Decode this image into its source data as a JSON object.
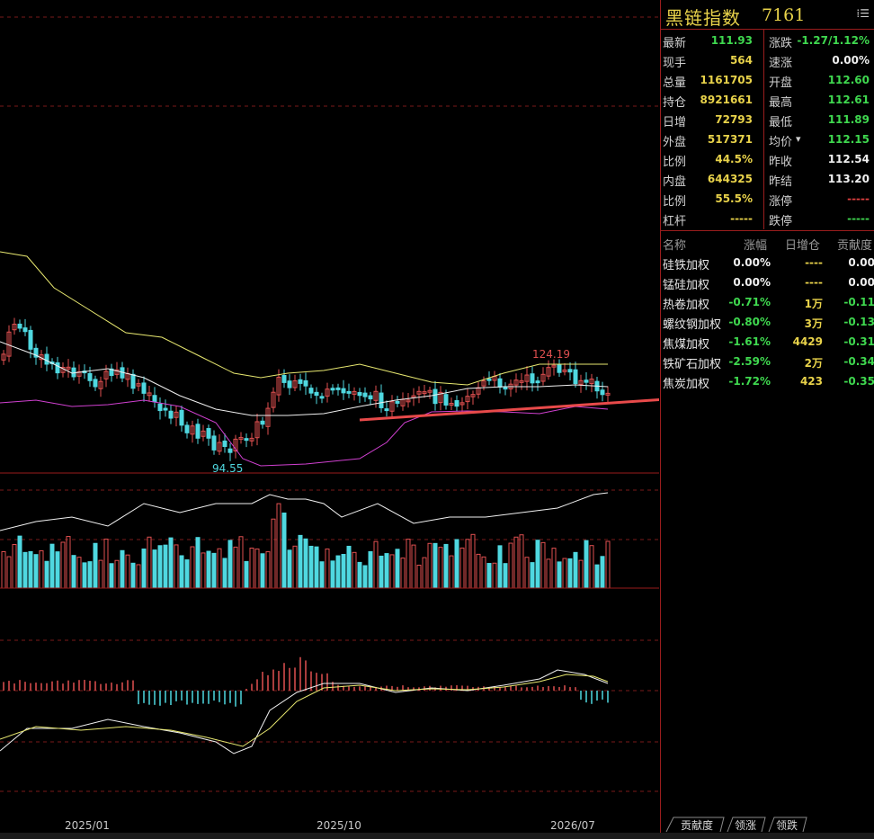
{
  "header": {
    "name": "黑链指数",
    "code": "7161",
    "menu_icon": "grid-menu-icon"
  },
  "quote": {
    "rows": [
      {
        "l1": "最新",
        "v1": "111.93",
        "c1": "#3fd84f",
        "l2": "涨跌",
        "v2": "-1.27/1.12%",
        "c2": "#3fd84f"
      },
      {
        "l1": "现手",
        "v1": "564",
        "c1": "#e8d24a",
        "l2": "速涨",
        "v2": "0.00%",
        "c2": "#f0f0f0"
      },
      {
        "l1": "总量",
        "v1": "1161705",
        "c1": "#e8d24a",
        "l2": "开盘",
        "v2": "112.60",
        "c2": "#3fd84f"
      },
      {
        "l1": "持仓",
        "v1": "8921661",
        "c1": "#e8d24a",
        "l2": "最高",
        "v2": "112.61",
        "c2": "#3fd84f"
      },
      {
        "l1": "日增",
        "v1": "72793",
        "c1": "#e8d24a",
        "l2": "最低",
        "v2": "111.89",
        "c2": "#3fd84f"
      },
      {
        "l1": "外盘",
        "v1": "517371",
        "c1": "#e8d24a",
        "l2": "均价",
        "v2": "112.15",
        "c2": "#3fd84f"
      },
      {
        "l1": "比例",
        "v1": "44.5%",
        "c1": "#e8d24a",
        "l2": "昨收",
        "v2": "112.54",
        "c2": "#f0f0f0"
      },
      {
        "l1": "内盘",
        "v1": "644325",
        "c1": "#e8d24a",
        "l2": "昨结",
        "v2": "113.20",
        "c2": "#f0f0f0"
      },
      {
        "l1": "比例",
        "v1": "55.5%",
        "c1": "#e8d24a",
        "l2": "涨停",
        "v2": "-----",
        "c2": "#e04040"
      },
      {
        "l1": "杠杆",
        "v1": "-----",
        "c1": "#e8d24a",
        "l2": "跌停",
        "v2": "-----",
        "c2": "#3fd84f"
      }
    ],
    "avg_dropdown_icon": "caret-down-icon"
  },
  "contrib": {
    "headers": {
      "name": "名称",
      "chg": "涨幅",
      "pos": "日增仓",
      "con": "贡献度"
    },
    "rows": [
      {
        "name": "硅铁加权",
        "chg": "0.00%",
        "chg_color": "#f0f0f0",
        "pos": "----",
        "pos_color": "#e8d24a",
        "con": "0.00",
        "con_color": "#f0f0f0"
      },
      {
        "name": "锰硅加权",
        "chg": "0.00%",
        "chg_color": "#f0f0f0",
        "pos": "----",
        "pos_color": "#e8d24a",
        "con": "0.00",
        "con_color": "#f0f0f0"
      },
      {
        "name": "热卷加权",
        "chg": "-0.71%",
        "chg_color": "#3fd84f",
        "pos": "1万",
        "pos_color": "#e8d24a",
        "con": "-0.11",
        "con_color": "#3fd84f"
      },
      {
        "name": "螺纹钢加权",
        "chg": "-0.80%",
        "chg_color": "#3fd84f",
        "pos": "3万",
        "pos_color": "#e8d24a",
        "con": "-0.13",
        "con_color": "#3fd84f"
      },
      {
        "name": "焦煤加权",
        "chg": "-1.61%",
        "chg_color": "#3fd84f",
        "pos": "4429",
        "pos_color": "#e8d24a",
        "con": "-0.31",
        "con_color": "#3fd84f"
      },
      {
        "name": "铁矿石加权",
        "chg": "-2.59%",
        "chg_color": "#3fd84f",
        "pos": "2万",
        "pos_color": "#e8d24a",
        "con": "-0.34",
        "con_color": "#3fd84f"
      },
      {
        "name": "焦炭加权",
        "chg": "-1.72%",
        "chg_color": "#3fd84f",
        "pos": "423",
        "pos_color": "#e8d24a",
        "con": "-0.35",
        "con_color": "#3fd84f"
      }
    ]
  },
  "tabs": [
    "贡献度",
    "领涨",
    "领跌"
  ],
  "chart": {
    "high_label": "124.19",
    "low_label": "94.55",
    "date_labels": [
      "2025/01",
      "2025/10",
      "2026/07"
    ],
    "up_color": "#e05050",
    "down_color": "#4fd8e0",
    "annotation_arrow_color": "#e84a4a"
  }
}
